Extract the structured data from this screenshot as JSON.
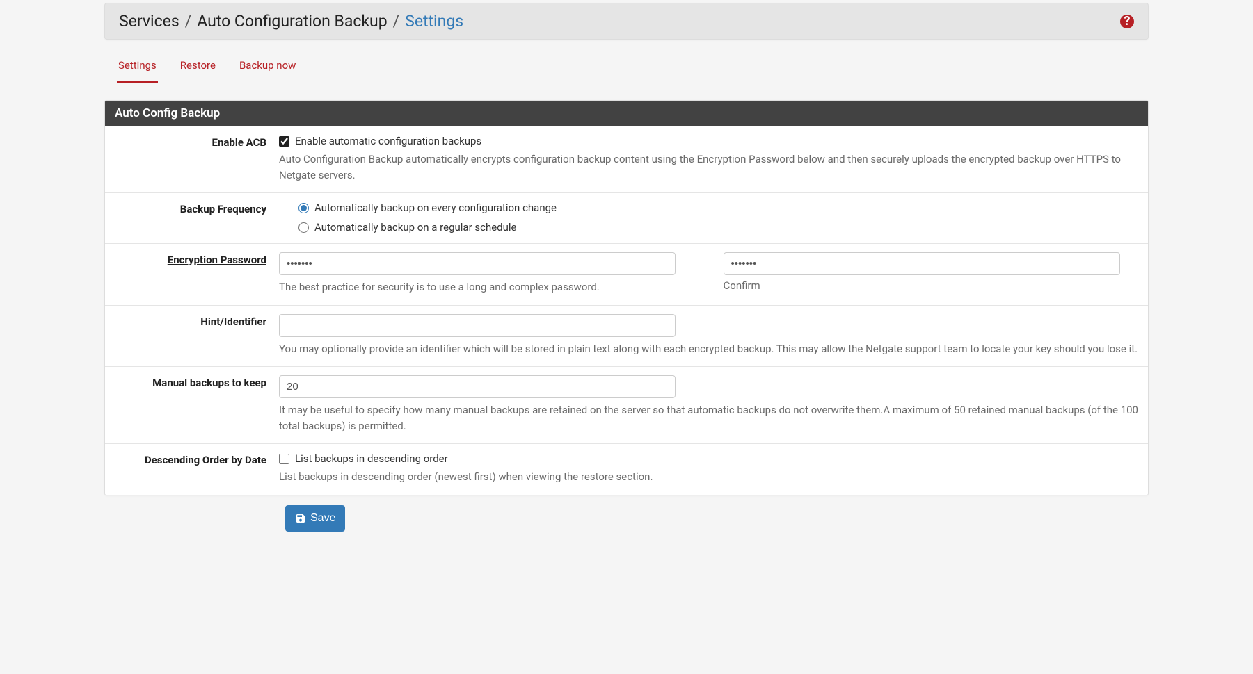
{
  "breadcrumb": {
    "level1": "Services",
    "level2": "Auto Configuration Backup",
    "level3": "Settings"
  },
  "tabs": {
    "settings": "Settings",
    "restore": "Restore",
    "backup_now": "Backup now"
  },
  "panel": {
    "title": "Auto Config Backup"
  },
  "enable_acb": {
    "label": "Enable ACB",
    "checkbox_checked": true,
    "checkbox_label": "Enable automatic configuration backups",
    "helper": "Auto Configuration Backup automatically encrypts configuration backup content using the Encryption Password below and then securely uploads the encrypted backup over HTTPS to Netgate servers."
  },
  "backup_frequency": {
    "label": "Backup Frequency",
    "option1": "Automatically backup on every configuration change",
    "option2": "Automatically backup on a regular schedule",
    "selected": "option1"
  },
  "encryption_password": {
    "label": "Encryption Password",
    "value": "•••••••",
    "helper": "The best practice for security is to use a long and complex password.",
    "confirm_value": "•••••••",
    "confirm_label": "Confirm"
  },
  "hint": {
    "label": "Hint/Identifier",
    "value": "",
    "helper": "You may optionally provide an identifier which will be stored in plain text along with each encrypted backup. This may allow the Netgate support team to locate your key should you lose it."
  },
  "manual_backups": {
    "label": "Manual backups to keep",
    "value": "20",
    "helper": "It may be useful to specify how many manual backups are retained on the server so that automatic backups do not overwrite them.A maximum of 50 retained manual backups (of the 100 total backups) is permitted."
  },
  "descending": {
    "label": "Descending Order by Date",
    "checkbox_checked": false,
    "checkbox_label": "List backups in descending order",
    "helper": "List backups in descending order (newest first) when viewing the restore section."
  },
  "save": {
    "label": "Save"
  }
}
